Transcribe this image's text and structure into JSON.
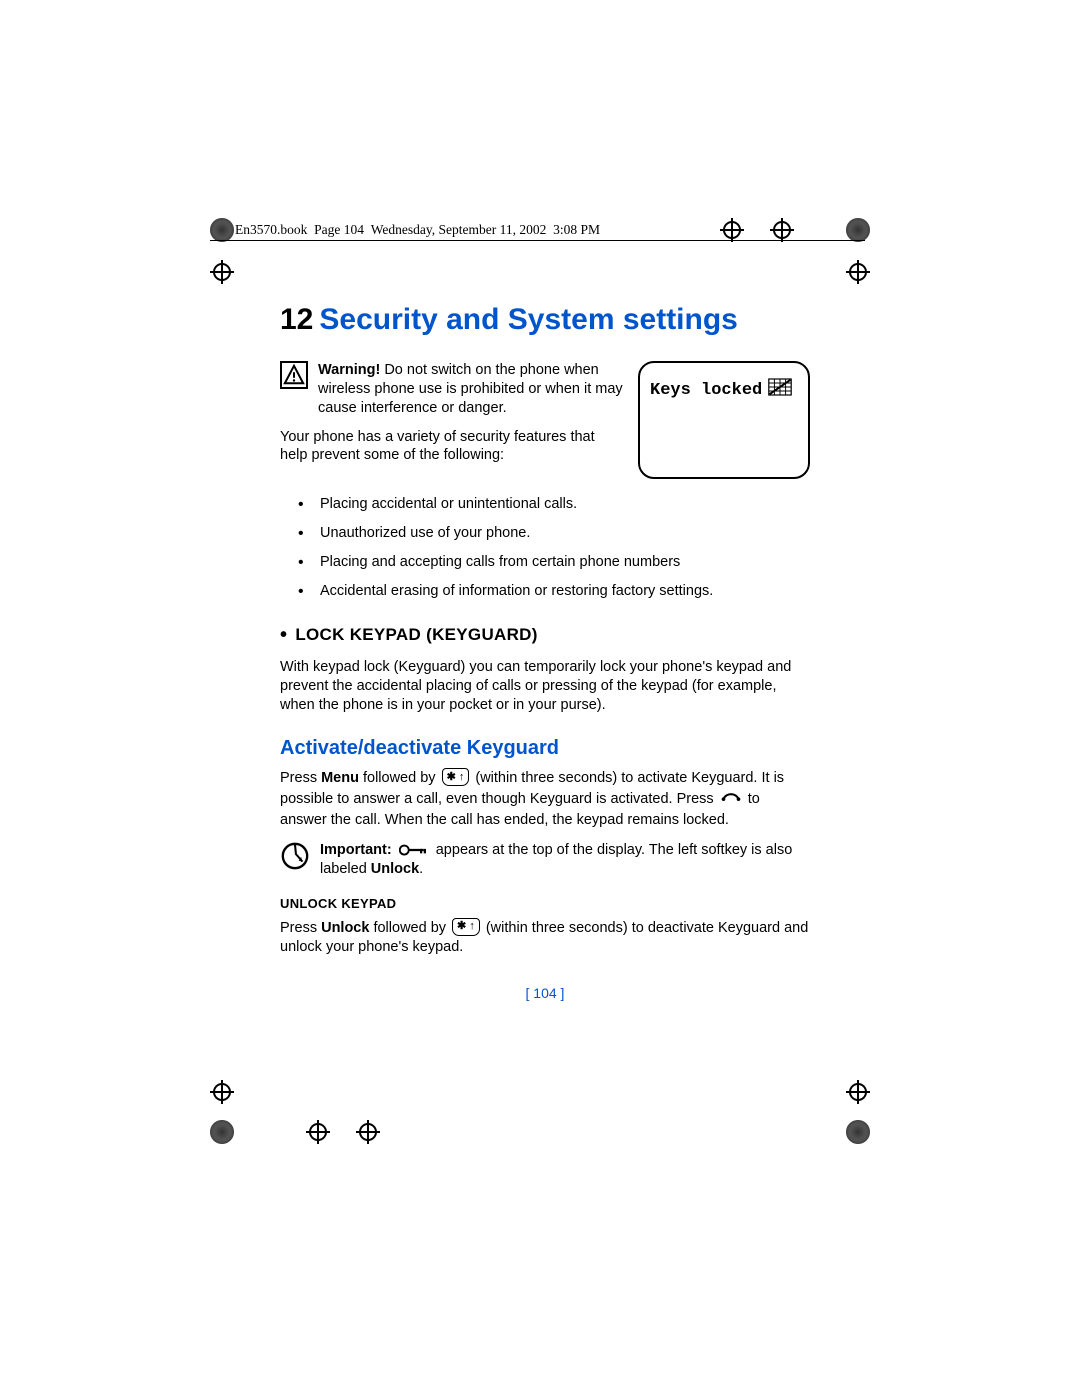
{
  "header": {
    "filename": "En3570.book",
    "page_ref": "Page 104",
    "day": "Wednesday, September 11, 2002",
    "time": "3:08 PM"
  },
  "chapter": {
    "number": "12",
    "title": "Security and System settings"
  },
  "warning": {
    "label": "Warning!",
    "text": " Do not switch on the phone when wireless phone use is prohibited or when it may cause interference or danger."
  },
  "intro": "Your phone has a variety of security features that help prevent some of the following:",
  "screen_label": "Keys locked",
  "bullets": [
    "Placing accidental or unintentional calls.",
    "Unauthorized use of your phone.",
    "Placing and accepting calls from certain phone numbers",
    "Accidental erasing of information or restoring factory settings."
  ],
  "section1": {
    "heading": "LOCK KEYPAD (KEYGUARD)",
    "para": "With keypad lock (Keyguard) you can temporarily lock your phone's keypad and prevent the accidental placing of calls or pressing of the keypad (for example, when the phone is in your pocket or in your purse)."
  },
  "subsection": {
    "heading": "Activate/deactivate Keyguard",
    "press": "Press ",
    "menu": "Menu",
    "followed_by": " followed by ",
    "key_label": "✱ ↑",
    "within1": " (within three seconds) to activate Keyguard. It is possible to answer a call, even though Keyguard is activated. Press ",
    "answer_rest": " to answer the call. When the call has ended, the keypad remains locked."
  },
  "important": {
    "label": "Important:",
    "text_before": " ",
    "text_mid": " appears at the top of the display. The left softkey is also labeled ",
    "unlock": "Unlock",
    "period": "."
  },
  "unlock_section": {
    "heading": "UNLOCK KEYPAD",
    "press": "Press ",
    "unlock": "Unlock",
    "followed_by": " followed by ",
    "key_label": "✱ ↑",
    "rest": " (within three seconds) to deactivate Keyguard and unlock your phone's keypad."
  },
  "page_number": "[ 104 ]"
}
